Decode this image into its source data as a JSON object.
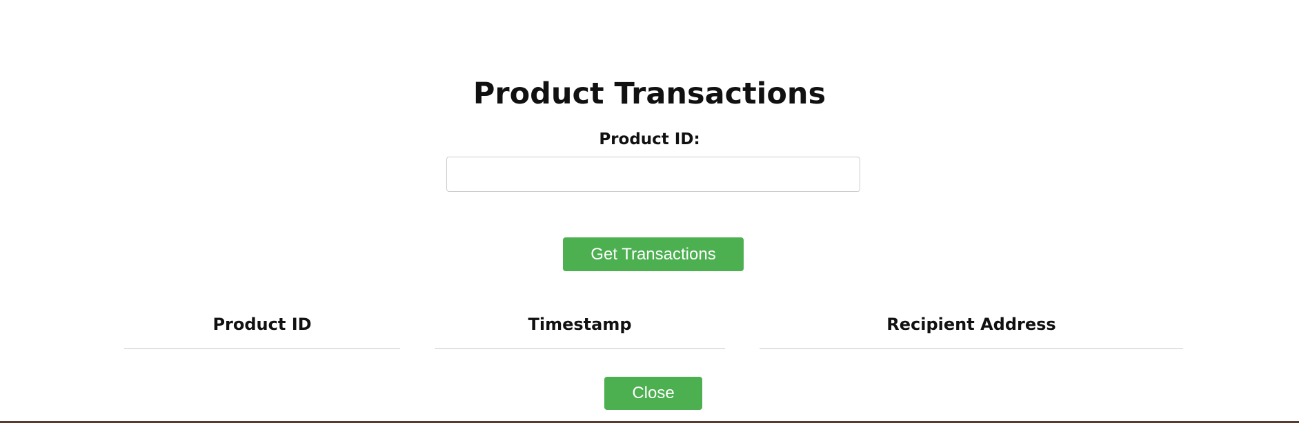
{
  "page": {
    "title": "Product Transactions"
  },
  "form": {
    "product_id_label": "Product ID:",
    "product_id_value": "",
    "get_button_label": "Get Transactions"
  },
  "table": {
    "columns": [
      "Product ID",
      "Timestamp",
      "Recipient Address"
    ],
    "rows": []
  },
  "footer": {
    "close_label": "Close"
  },
  "colors": {
    "button": "#4caf50",
    "button_text": "#ffffff",
    "background_edge": "#5a3a2e"
  }
}
